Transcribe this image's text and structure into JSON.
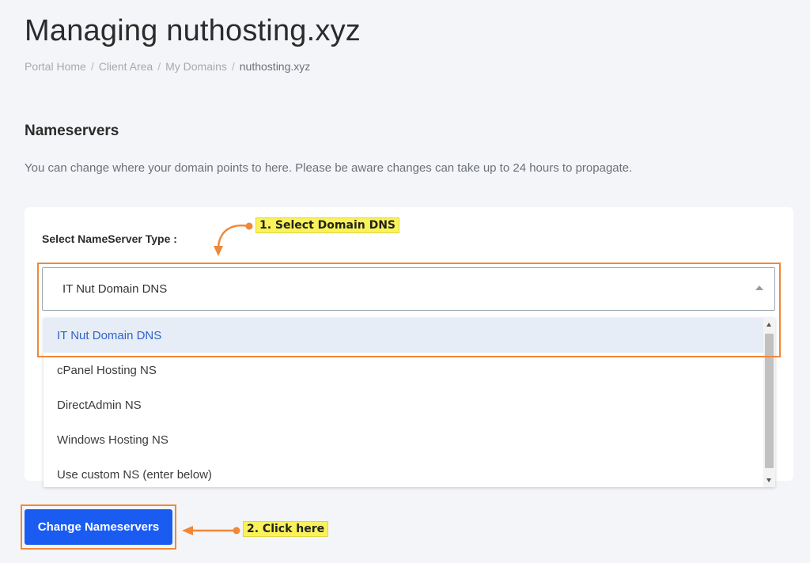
{
  "page": {
    "title": "Managing nuthosting.xyz",
    "breadcrumb": [
      "Portal Home",
      "Client Area",
      "My Domains",
      "nuthosting.xyz"
    ]
  },
  "nameservers": {
    "heading": "Nameservers",
    "description": "You can change where your domain points to here. Please be aware changes can take up to 24 hours to propagate.",
    "select_label": "Select NameServer Type :",
    "selected_value": "IT Nut Domain DNS",
    "options": [
      {
        "label": "IT Nut Domain DNS",
        "selected": true
      },
      {
        "label": "cPanel Hosting NS",
        "selected": false
      },
      {
        "label": "DirectAdmin NS",
        "selected": false
      },
      {
        "label": "Windows Hosting NS",
        "selected": false
      },
      {
        "label": "Use custom NS (enter below)",
        "selected": false
      }
    ],
    "submit_label": "Change Nameservers"
  },
  "annotations": {
    "step1": "1. Select Domain DNS",
    "step2": "2. Click here",
    "highlight_color": "#f0883a",
    "label_bg_color": "#f9f25a"
  },
  "colors": {
    "primary_button": "#1a5cf2",
    "selected_option_text": "#2f63c8",
    "selected_option_bg": "#e7edf7"
  }
}
